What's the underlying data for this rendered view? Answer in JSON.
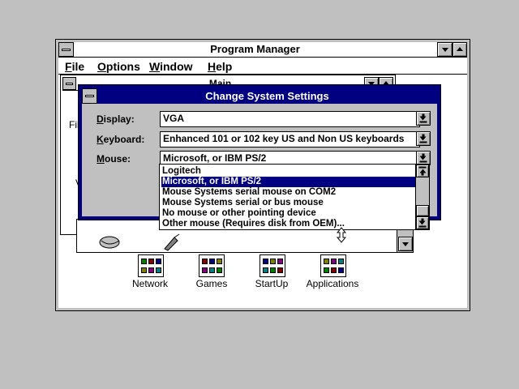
{
  "program_manager": {
    "title": "Program Manager",
    "menu": [
      {
        "label": "File",
        "mnemonic": "F",
        "rest": "ile"
      },
      {
        "label": "Options",
        "mnemonic": "O",
        "rest": "ptions"
      },
      {
        "label": "Window",
        "mnemonic": "W",
        "rest": "indow"
      },
      {
        "label": "Help",
        "mnemonic": "H",
        "rest": "elp"
      }
    ]
  },
  "main_window": {
    "title": "Main",
    "partial_text_1": "Fil",
    "partial_text_2": "V"
  },
  "groups": [
    {
      "label": "Network"
    },
    {
      "label": "Games"
    },
    {
      "label": "StartUp"
    },
    {
      "label": "Applications"
    }
  ],
  "dialog": {
    "title": "Change System Settings",
    "display": {
      "label": "Display:",
      "mnemonic": "D",
      "rest": "isplay:",
      "value": "VGA"
    },
    "keyboard": {
      "label": "Keyboard:",
      "mnemonic": "K",
      "rest": "eyboard:",
      "value": "Enhanced 101 or 102 key US and Non US keyboards"
    },
    "mouse": {
      "label": "Mouse:",
      "mnemonic": "M",
      "rest": "ouse:",
      "value": "Microsoft, or IBM PS/2",
      "options": [
        "Logitech",
        "Microsoft, or IBM PS/2",
        "Mouse Systems serial mouse on COM2",
        "Mouse Systems serial or bus mouse",
        "No mouse or other pointing device",
        "Other mouse (Requires disk from OEM)..."
      ],
      "selected_index": 1
    }
  },
  "colors": {
    "desktop": "#c0c0c0",
    "title_active": "#000080",
    "title_inactive": "#ffffff",
    "selection": "#000080"
  }
}
